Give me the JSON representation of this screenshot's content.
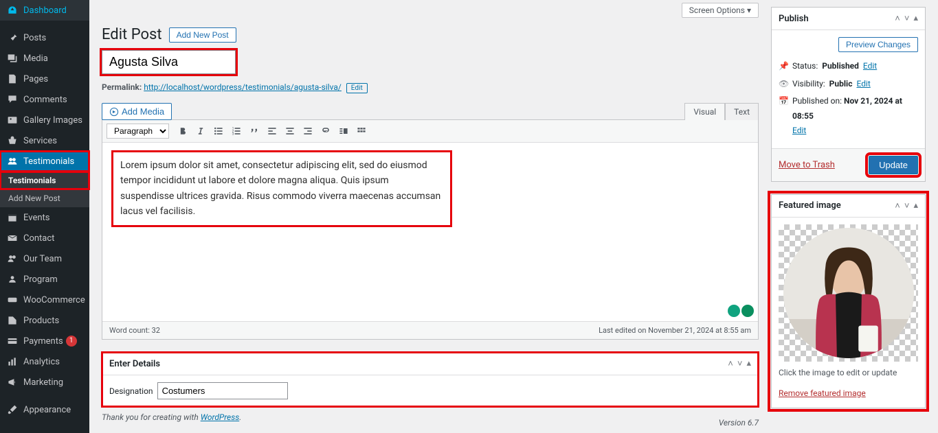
{
  "screenOptions": "Screen Options ▾",
  "sidebar": {
    "items": [
      {
        "label": "Dashboard"
      },
      {
        "label": "Posts"
      },
      {
        "label": "Media"
      },
      {
        "label": "Pages"
      },
      {
        "label": "Comments"
      },
      {
        "label": "Gallery Images"
      },
      {
        "label": "Services"
      },
      {
        "label": "Testimonials"
      },
      {
        "label": "Events"
      },
      {
        "label": "Contact"
      },
      {
        "label": "Our Team"
      },
      {
        "label": "Program"
      },
      {
        "label": "WooCommerce"
      },
      {
        "label": "Products"
      },
      {
        "label": "Payments"
      },
      {
        "label": "Analytics"
      },
      {
        "label": "Marketing"
      },
      {
        "label": "Appearance"
      }
    ],
    "sub": [
      "Testimonials",
      "Add New Post"
    ],
    "paymentsBadge": "1"
  },
  "page": {
    "title": "Edit Post",
    "addNew": "Add New Post"
  },
  "post": {
    "title": "Agusta Silva",
    "permalinkLabel": "Permalink:",
    "permalinkBase": "http://localhost/wordpress/testimonials/",
    "permalinkSlug": "agusta-silva/",
    "editSlug": "Edit"
  },
  "editor": {
    "addMedia": "Add Media",
    "visual": "Visual",
    "text": "Text",
    "format": "Paragraph",
    "body": "Lorem ipsum dolor sit amet, consectetur adipiscing elit, sed do eiusmod tempor incididunt ut labore et dolore magna aliqua. Quis ipsum suspendisse ultrices gravida. Risus commodo viverra maecenas accumsan lacus vel facilisis.",
    "wordCount": "Word count: 32",
    "lastEdited": "Last edited on November 21, 2024 at 8:55 am"
  },
  "details": {
    "title": "Enter Details",
    "designationLabel": "Designation",
    "designation": "Costumers"
  },
  "publish": {
    "title": "Publish",
    "preview": "Preview Changes",
    "statusLabel": "Status:",
    "status": "Published",
    "visibilityLabel": "Visibility:",
    "visibility": "Public",
    "publishedLabel": "Published on:",
    "published": "Nov 21, 2024 at 08:55",
    "edit": "Edit",
    "trash": "Move to Trash",
    "update": "Update"
  },
  "featured": {
    "title": "Featured image",
    "help": "Click the image to edit or update",
    "remove": "Remove featured image"
  },
  "footer": {
    "thank": "Thank you for creating with ",
    "wp": "WordPress",
    "dot": ".",
    "version": "Version 6.7"
  }
}
